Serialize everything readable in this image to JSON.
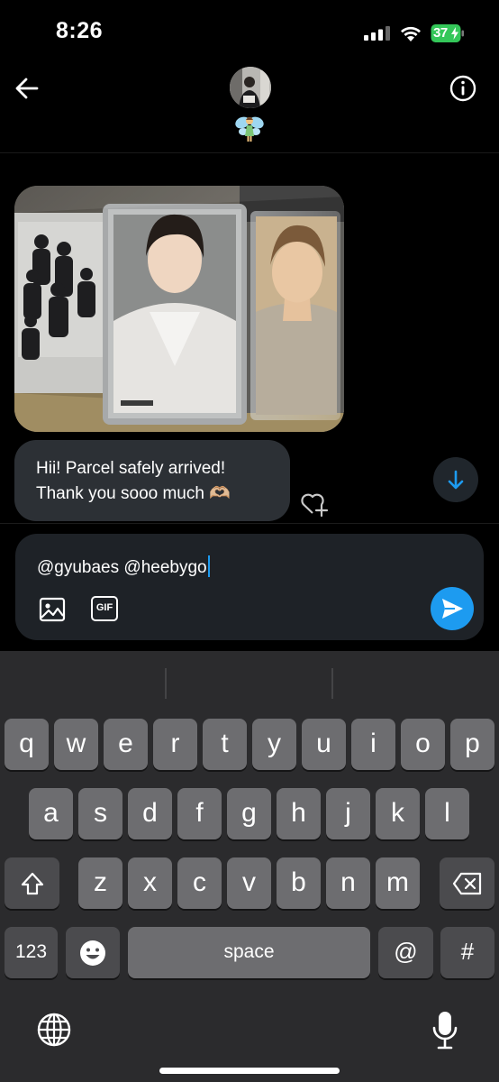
{
  "status_bar": {
    "time": "8:26",
    "battery_level": "37"
  },
  "header": {
    "avatar_icon": "profile-avatar",
    "badge_icon": "fairy-emoji"
  },
  "chat": {
    "message_text_line1": "Hii! Parcel safely arrived!",
    "message_text_line2": "Thank you sooo much 🫶🏼"
  },
  "composer": {
    "value": "@gyubaes @heebygo",
    "gif_label": "GIF",
    "accent_color": "#1d9bf0"
  },
  "keyboard": {
    "row1": [
      "q",
      "w",
      "e",
      "r",
      "t",
      "y",
      "u",
      "i",
      "o",
      "p"
    ],
    "row2": [
      "a",
      "s",
      "d",
      "f",
      "g",
      "h",
      "j",
      "k",
      "l"
    ],
    "row3": [
      "z",
      "x",
      "c",
      "v",
      "b",
      "n",
      "m"
    ],
    "numbers_label": "123",
    "space_label": "space",
    "at_label": "@",
    "hash_label": "#"
  }
}
